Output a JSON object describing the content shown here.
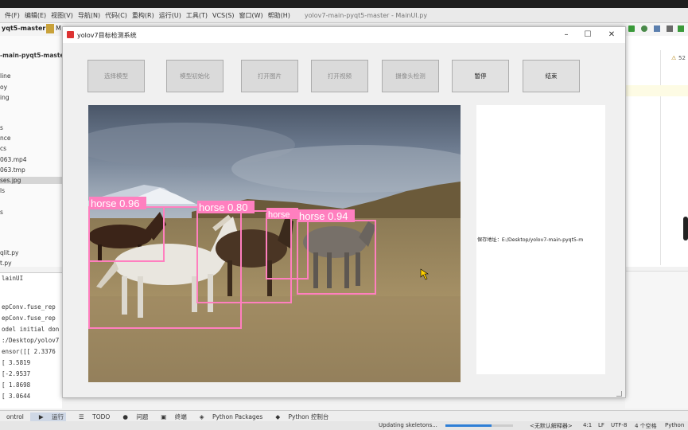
{
  "ide": {
    "menu": [
      "件(F)",
      "编辑(E)",
      "视图(V)",
      "导航(N)",
      "代码(C)",
      "重构(R)",
      "运行(U)",
      "工具(T)",
      "VCS(S)",
      "窗口(W)",
      "帮助(H)"
    ],
    "window_title": "yolov7-main-pyqt5-master - MainUI.py",
    "breadcrumb": "yqt5-master",
    "tab_fragment": "M",
    "project_root": "-main-pyqt5-maste",
    "tree": [
      "line",
      "oy",
      "ing",
      "s",
      "nce",
      "cs",
      "063.mp4",
      "063.tmp",
      "ses.jpg",
      "ls",
      "s",
      "qlit.py",
      "t.py"
    ],
    "selected_index": 8,
    "run_tab": "lainUI",
    "console": [
      "epConv.fuse_rep",
      "epConv.fuse_rep",
      "odel initial don",
      ":/Desktop/yolov7",
      "ensor([[ 2.3376",
      "    [ 3.5819",
      "    [-2.9537",
      "    [ 1.8698",
      "    [ 3.0644"
    ],
    "warning_count": "52",
    "bottom_tabs": [
      "ontrol",
      "运行",
      "TODO",
      "问题",
      "终端",
      "Python Packages",
      "Python 控制台"
    ],
    "status": {
      "task": "Updating skeletons...",
      "interpreter": "<无默认解释器>",
      "position": "4:1",
      "line_sep": "LF",
      "encoding": "UTF-8",
      "indent": "4 个空格",
      "lang": "Python"
    },
    "progress": 0.68
  },
  "app": {
    "title": "yolov7目标检测系统",
    "controls": {
      "minimize": "–",
      "maximize": "☐",
      "close": "✕"
    },
    "buttons": [
      {
        "label": "选择模型",
        "enabled": false
      },
      {
        "label": "模型初始化",
        "enabled": false
      },
      {
        "label": "打开图片",
        "enabled": false
      },
      {
        "label": "打开视频",
        "enabled": false
      },
      {
        "label": "摄像头检测",
        "enabled": false
      },
      {
        "label": "暂停",
        "enabled": true
      },
      {
        "label": "结束",
        "enabled": true
      }
    ],
    "result_text": "保存地址：E:/Desktop/yolov7-main-pyqt5-m",
    "detections": [
      {
        "label": "horse 0.96"
      },
      {
        "label": "horse 0.80"
      },
      {
        "label": "horse"
      },
      {
        "label": "horse 0.94"
      }
    ],
    "colors": {
      "box": "#ff7fbf",
      "window_bg": "#f0f0f0",
      "accent": "#2f7fd6"
    }
  }
}
